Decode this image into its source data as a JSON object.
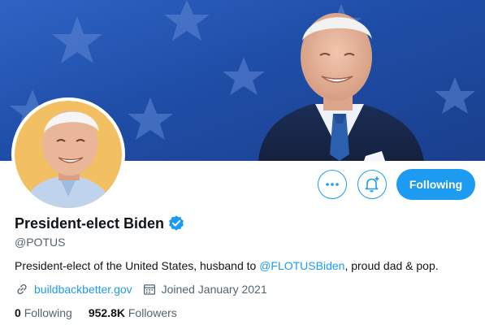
{
  "profile": {
    "display_name": "President-elect Biden",
    "handle": "@POTUS",
    "bio_prefix": "President-elect of the United States, husband to ",
    "bio_mention": "@FLOTUSBiden",
    "bio_suffix": ", proud dad & pop.",
    "website": "buildbackbetter.gov",
    "joined": "Joined January 2021",
    "following_count": "0",
    "following_label": "Following",
    "followers_count": "952.8K",
    "followers_label": "Followers",
    "verified": true
  },
  "actions": {
    "more_icon": "more-icon",
    "notify_icon": "bell-plus-icon",
    "follow_label": "Following"
  },
  "icons": {
    "link": "link-icon",
    "calendar": "calendar-icon",
    "verified": "verified-badge-icon"
  },
  "colors": {
    "accent": "#1d9bf0",
    "text": "#0f1419",
    "secondary_text": "#536471",
    "banner_blue": "#2f63c4"
  }
}
